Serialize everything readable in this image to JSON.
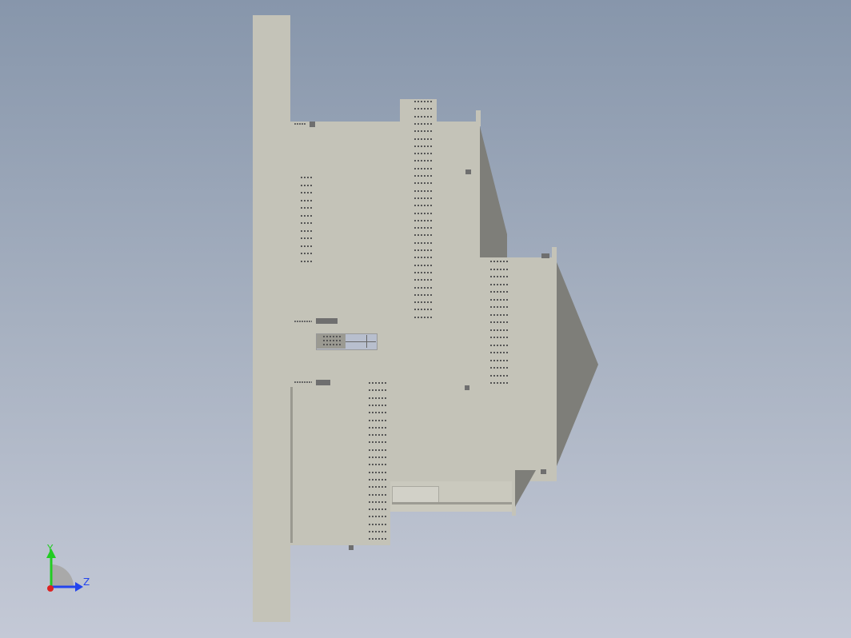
{
  "viewport": {
    "background_top": "#8796ab",
    "background_bottom": "#c4c9d6",
    "model_color": "#c4c3b8",
    "shadow_color": "#7e7e79"
  },
  "triad": {
    "x_label": "",
    "y_label": "Y",
    "z_label": "Z",
    "y_color": "#22cc22",
    "z_color": "#2244ee",
    "origin_color": "#dd2222"
  }
}
